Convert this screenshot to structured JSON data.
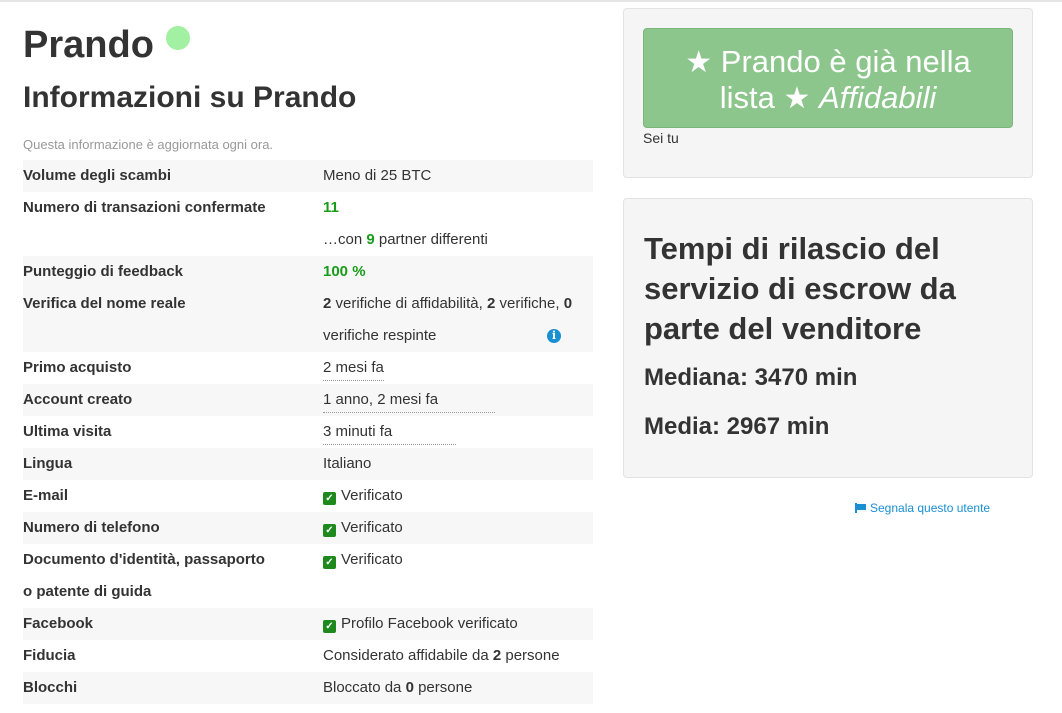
{
  "profile": {
    "username": "Prando",
    "title": "Informazioni su Prando",
    "notice": "Questa informazione è aggiornata ogni ora."
  },
  "info": {
    "trade_volume_label": "Volume degli scambi",
    "trade_volume_value": "Meno di 25 BTC",
    "confirmed_trades_label": "Numero di transazioni confermate",
    "confirmed_trades_value": "11",
    "partners_prefix": "…con",
    "partners_count": "9",
    "partners_suffix": "partner differenti",
    "feedback_label": "Punteggio di feedback",
    "feedback_value": "100 %",
    "real_name_label": "Verifica del nome reale",
    "real_name_trust_count": "2",
    "real_name_trust_text": "verifiche di affidabilità,",
    "real_name_verif_count": "2",
    "real_name_verif_text": "verifiche,",
    "real_name_rejected_count": "0",
    "real_name_rejected_text": "verifiche respinte",
    "first_purchase_label": "Primo acquisto",
    "first_purchase_value": "2 mesi fa",
    "account_created_label": "Account creato",
    "account_created_value": "1 anno, 2 mesi fa",
    "last_seen_label": "Ultima visita",
    "last_seen_value": "3 minuti fa",
    "language_label": "Lingua",
    "language_value": "Italiano",
    "email_label": "E-mail",
    "email_value": "Verificato",
    "phone_label": "Numero di telefono",
    "phone_value": "Verificato",
    "id_label_line1": "Documento d'identità, passaporto",
    "id_label_line2": "o patente di guida",
    "id_value": "Verificato",
    "facebook_label": "Facebook",
    "facebook_value": "Profilo Facebook verificato",
    "trust_label": "Fiducia",
    "trust_prefix": "Considerato affidabile da",
    "trust_count": "2",
    "trust_suffix": "persone",
    "blocks_label": "Blocchi",
    "blocks_prefix": "Bloccato da",
    "blocks_count": "0",
    "blocks_suffix": "persone"
  },
  "trusted": {
    "line1": "Prando è già nella",
    "line2_prefix": "lista",
    "list_name": "Affidabili",
    "star_glyph": "★",
    "you_label": "Sei tu"
  },
  "escrow": {
    "title": "Tempi di rilascio del servizio di escrow da parte del venditore",
    "median": "Mediana: 3470 min",
    "mean": "Media: 2967 min"
  },
  "report": {
    "label": "Segnala questo utente"
  },
  "colors": {
    "online": "#a2f0a2",
    "trusted_button": "#8cc68c",
    "positive": "#1a9c1a",
    "link": "#1a8fd1"
  },
  "icons": {
    "status": "online-dot-icon",
    "info": "info-icon",
    "check": "checkbox-checked-icon",
    "star": "star-icon",
    "flag": "flag-icon"
  }
}
